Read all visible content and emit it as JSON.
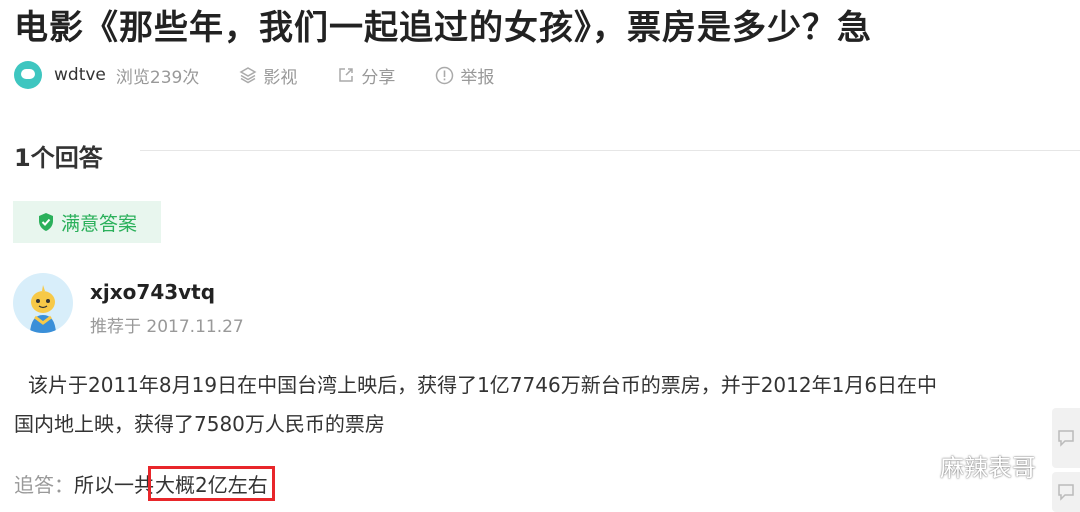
{
  "question": {
    "title": "电影《那些年，我们一起追过的女孩》，票房是多少？急",
    "asker": "wdtve",
    "views": "浏览239次",
    "category": "影视",
    "share": "分享",
    "report": "举报"
  },
  "answers_header": "1个回答",
  "best_answer_badge": "满意答案",
  "answer": {
    "user": "xjxo743vtq",
    "recommended": "推荐于 2017.11.27",
    "line1": "该片于2011年8月19日在中国台湾上映后，获得了1亿7746万新台币的票房，并于2012年1月6日在中",
    "line2": "国内地上映，获得了7580万人民币的票房",
    "followup_label": "追答：",
    "followup_text": "所以一共",
    "followup_highlight": "大概2亿左右"
  },
  "watermark": "麻辣表哥",
  "colors": {
    "accent_green": "#2bb05b",
    "highlight_red": "#e8262a"
  }
}
